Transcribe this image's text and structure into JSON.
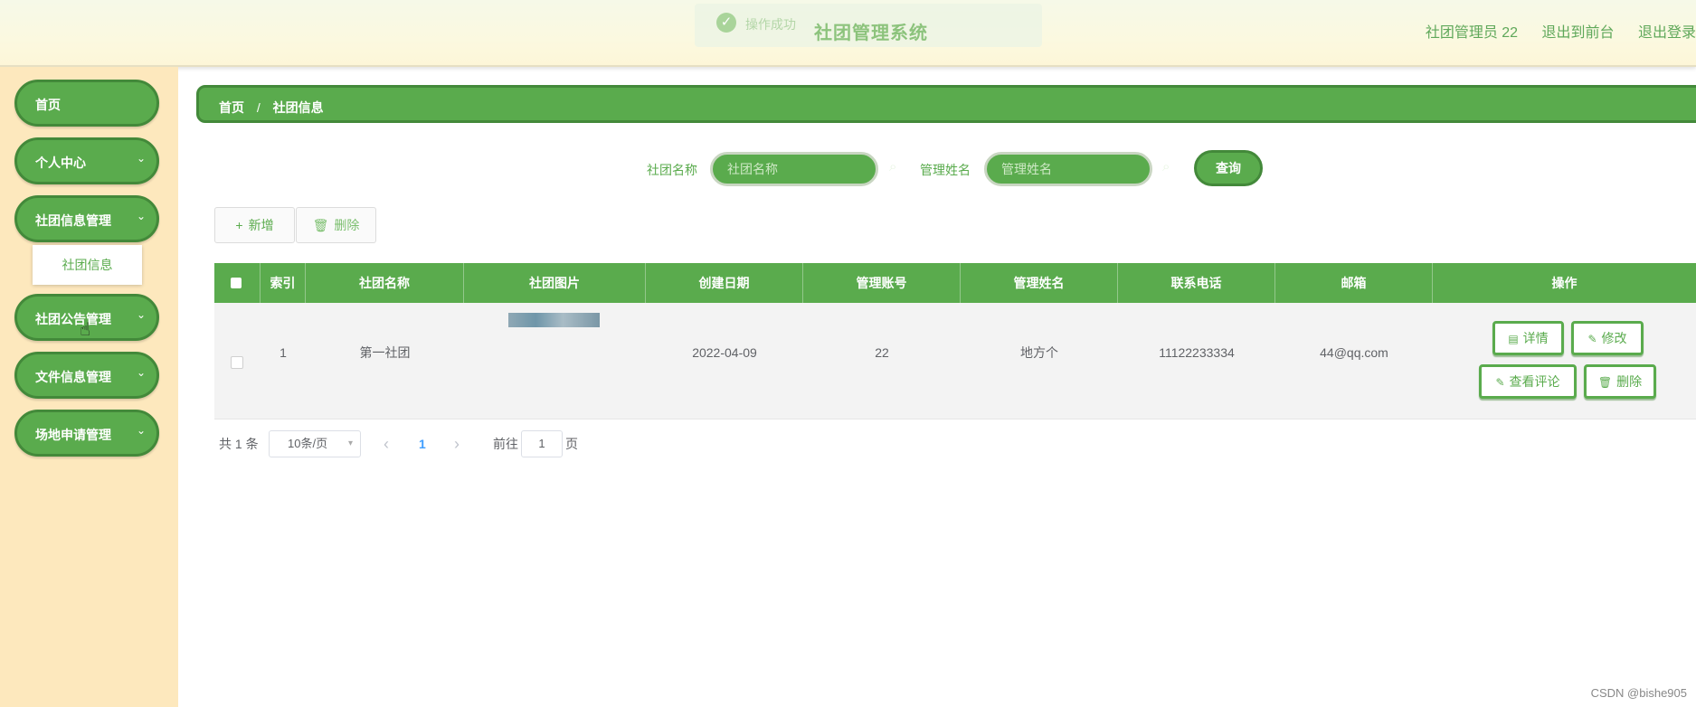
{
  "header": {
    "toast_icon": "✓",
    "toast_text": "操作成功",
    "title": "社团管理系统",
    "user": "社团管理员 22",
    "to_front": "退出到前台",
    "logout": "退出登录"
  },
  "sidebar": {
    "items": [
      {
        "label": "首页"
      },
      {
        "label": "个人中心",
        "chev": "⌄"
      },
      {
        "label": "社团信息管理",
        "chev": "⌄"
      },
      {
        "label": "社团公告管理",
        "chev": "⌄"
      },
      {
        "label": "文件信息管理",
        "chev": "⌄"
      },
      {
        "label": "场地申请管理",
        "chev": "⌄"
      }
    ],
    "submenu_label": "社团信息"
  },
  "breadcrumb": {
    "home": "首页",
    "separator": "/",
    "current": "社团信息"
  },
  "search": {
    "name_label": "社团名称",
    "name_placeholder": "社团名称",
    "manager_label": "管理姓名",
    "manager_placeholder": "管理姓名",
    "query_label": "查询"
  },
  "actions": {
    "add_icon": "+",
    "add_label": "新增",
    "delete_icon": "🗑",
    "delete_label": "删除"
  },
  "table": {
    "headers": [
      "索引",
      "社团名称",
      "社团图片",
      "创建日期",
      "管理账号",
      "管理姓名",
      "联系电话",
      "邮箱",
      "操作"
    ],
    "rows": [
      {
        "index": "1",
        "name": "第一社团",
        "date": "2022-04-09",
        "account": "22",
        "manager": "地方个",
        "phone": "11122233334",
        "email": "44@qq.com",
        "ops": {
          "detail": "详情",
          "edit": "修改",
          "comments": "查看评论",
          "delete": "删除"
        }
      }
    ]
  },
  "pagination": {
    "total": "共 1 条",
    "page_size": "10条/页",
    "prev": "‹",
    "current_page": "1",
    "next": "›",
    "goto_label": "前往",
    "goto_value": "1",
    "page_suffix": "页"
  },
  "watermark": "CSDN @bishe905",
  "colors": {
    "accent": "#5aab4d",
    "accent_dark": "#43893a",
    "sidebar_bg": "#fde8bd"
  }
}
